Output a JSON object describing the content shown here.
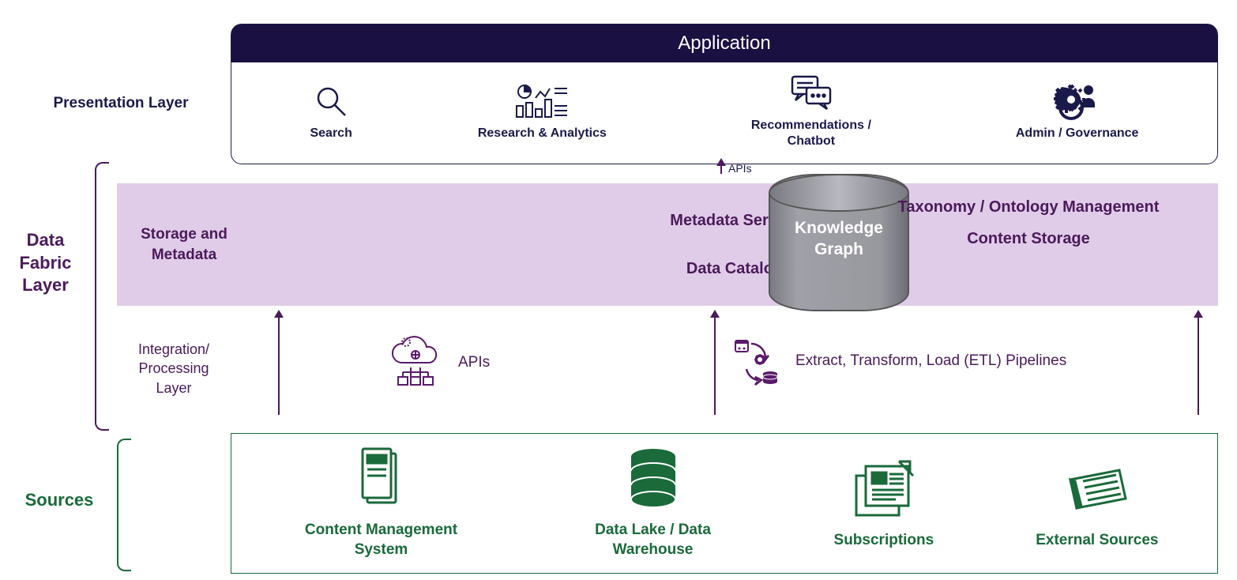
{
  "labels": {
    "presentation": "Presentation Layer",
    "fabric": "Data Fabric Layer",
    "sources": "Sources"
  },
  "application": {
    "header": "Application",
    "items": [
      {
        "label": "Search",
        "icon": "search-icon"
      },
      {
        "label": "Research & Analytics",
        "icon": "analytics-icon"
      },
      {
        "label": "Recommendations / Chatbot",
        "icon": "chat-icon"
      },
      {
        "label": "Admin / Governance",
        "icon": "admin-icon"
      }
    ]
  },
  "storage": {
    "sublabel": "Storage and Metadata",
    "left": {
      "line1": "Metadata Service",
      "line2": "Data Catalog"
    },
    "kg": {
      "line1": "Knowledge",
      "line2": "Graph"
    },
    "right": {
      "line1": "Taxonomy / Ontology Management",
      "line2": "Content Storage"
    }
  },
  "integration": {
    "label": "Integration/ Processing Layer",
    "apis": "APIs",
    "etl": "Extract, Transform, Load (ETL) Pipelines"
  },
  "arrow_api_label": "APIs",
  "sources_box": {
    "items": [
      {
        "label": "Content Management System",
        "icon": "cms-icon"
      },
      {
        "label": "Data Lake / Data Warehouse",
        "icon": "database-icon"
      },
      {
        "label": "Subscriptions",
        "icon": "subscriptions-icon"
      },
      {
        "label": "External Sources",
        "icon": "external-icon"
      }
    ]
  },
  "colors": {
    "dark_navy": "#1a1042",
    "navy_text": "#1a1a4a",
    "purple": "#4a1a5a",
    "lavender": "#e0cce8",
    "green": "#1a6a3a"
  }
}
